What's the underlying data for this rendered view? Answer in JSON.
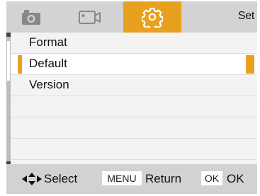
{
  "tabs": [
    {
      "name": "camera",
      "icon": "camera-icon"
    },
    {
      "name": "video",
      "icon": "video-camera-icon"
    },
    {
      "name": "settings",
      "icon": "gear-icon",
      "active": true
    }
  ],
  "header": {
    "title": "Set"
  },
  "menu": {
    "items": [
      {
        "label": "Format"
      },
      {
        "label": "Default",
        "selected": true
      },
      {
        "label": "Version"
      }
    ],
    "empty_rows": 3
  },
  "footer": {
    "select_icon": "arrows-icon",
    "select_label": "Select",
    "menu_key": "MENU",
    "return_label": "Return",
    "ok_key": "OK",
    "ok_label": "OK"
  },
  "colors": {
    "accent": "#e8a020",
    "tabbar": "#d3d3d3",
    "frame": "#444444"
  }
}
